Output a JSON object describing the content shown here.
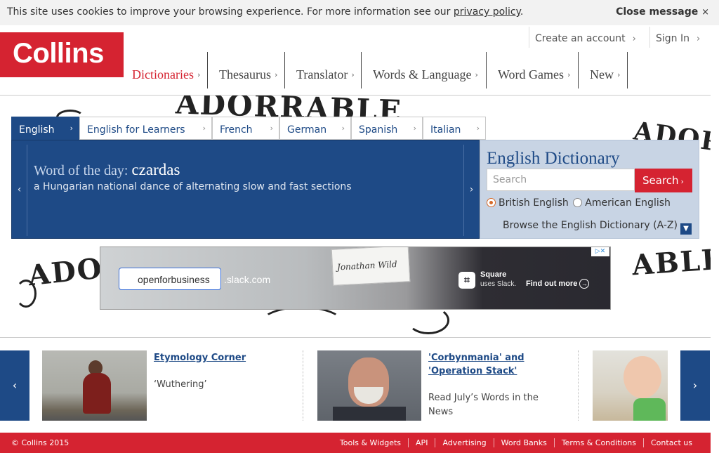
{
  "cookie": {
    "message": "This site uses cookies to improve your browsing experience. For more information see our",
    "link": "privacy policy",
    "period": ".",
    "close_label": "Close message",
    "close_icon": "×"
  },
  "header": {
    "logo": "Collins",
    "create_account": "Create an account",
    "sign_in": "Sign In",
    "nav": [
      {
        "label": "Dictionaries",
        "active": true
      },
      {
        "label": "Thesaurus"
      },
      {
        "label": "Translator"
      },
      {
        "label": "Words & Language"
      },
      {
        "label": "Word Games"
      },
      {
        "label": "New"
      }
    ],
    "chevron": "›"
  },
  "tabs": [
    "English",
    "English for Learners",
    "French",
    "German",
    "Spanish",
    "Italian"
  ],
  "wotd": {
    "prefix": "Word of the day:",
    "word": "czardas",
    "definition": "a Hungarian national dance of alternating slow and fast sections"
  },
  "dictionary": {
    "heading": "English Dictionary",
    "search_placeholder": "Search",
    "search_button": "Search",
    "radio_british": "British English",
    "radio_american": "American English",
    "browse": "Browse the English Dictionary (A-Z)"
  },
  "ad": {
    "card_text": "Jonathan Wild",
    "domain_value": "openforbusiness",
    "domain_suffix": ".slack.com",
    "brand": "Square",
    "brand_sub": "uses Slack.",
    "cta": "Find out more",
    "adchoice": "▷✕"
  },
  "doodles": {
    "top": "ADORRABLE",
    "left": "ADOR",
    "right_top": "ADOR",
    "right_bottom": "ABLE"
  },
  "carousel": {
    "cards": [
      {
        "title": "Etymology Corner",
        "subtitle": "‘Wuthering’"
      },
      {
        "title": "'Corbynmania' and 'Operation Stack'",
        "subtitle": "Read July’s Words in the News"
      }
    ]
  },
  "footer": {
    "copyright": "© Collins 2015",
    "links": [
      "Tools & Widgets",
      "API",
      "Advertising",
      "Word Banks",
      "Terms & Conditions",
      "Contact us"
    ]
  },
  "colors": {
    "brand_red": "#d52331",
    "brand_blue": "#1e4a86",
    "dict_panel": "#c8d4e4"
  }
}
